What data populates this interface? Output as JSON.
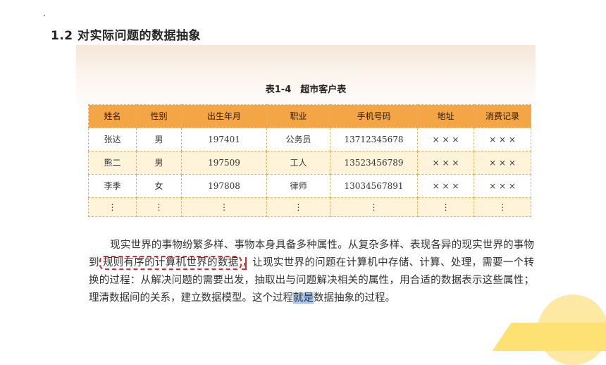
{
  "page": {
    "heading": "1.2 对实际问题的数据抽象"
  },
  "table": {
    "caption": "表1-4　超市客户表",
    "headers": [
      "姓名",
      "性别",
      "出生年月",
      "职业",
      "手机号码",
      "地址",
      "消费记录"
    ],
    "rows": [
      [
        "张达",
        "男",
        "197401",
        "公务员",
        "13712345678",
        "× × ×",
        "× × ×"
      ],
      [
        "熊二",
        "男",
        "197509",
        "工人",
        "13523456789",
        "× × ×",
        "× × ×"
      ],
      [
        "李季",
        "女",
        "197808",
        "律师",
        "13034567891",
        "× × ×",
        "× × ×"
      ],
      [
        "⋮",
        "⋮",
        "⋮",
        "⋮",
        "⋮",
        "⋮",
        "⋮"
      ]
    ]
  },
  "paragraph": {
    "part1": "现实世界的事物纷繁多样、事物本身具备多种属性。从复杂多样、表现各异的现实世界的事物到",
    "boxed": "规则有序的计算机世界的数据",
    "part2": "，让现实世界的问题在计算机中存储、计算、处理，需要一个转换的过程：从解决问题的需要出发，抽取出与问题解决相关的属性，用合适的数据表示这些属性；理清数据间的关系，建立数据模型。这个过程",
    "highlighted": "就是",
    "part3": "数据抽象的过程。"
  },
  "colors": {
    "header_fill": "#f4a545",
    "alt_row_fill": "#fff4d9",
    "annotation_box": "#e02a2a",
    "text_highlight": "#a9c7ee",
    "deco_yellow": "#fde173"
  }
}
